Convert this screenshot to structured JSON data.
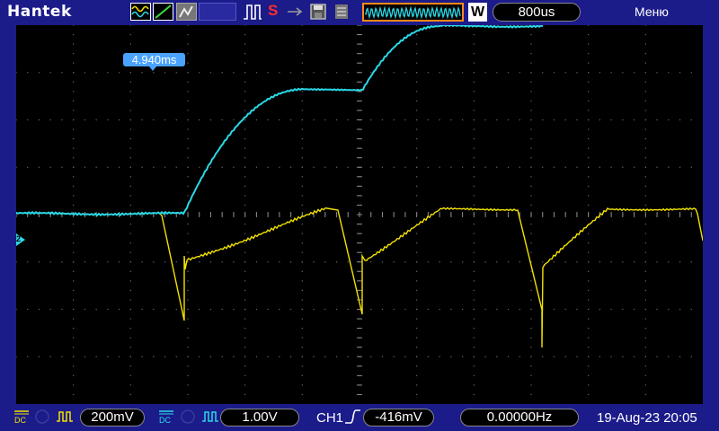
{
  "header": {
    "brand": "Hantek",
    "status": "S",
    "w_badge": "W",
    "timebase": "800us",
    "menu": "Меню"
  },
  "screen": {
    "trigger_position": "4.940ms",
    "ch2_marker": "2"
  },
  "footer": {
    "ch1_coupling": "DC",
    "ch1_scale": "200mV",
    "ch2_coupling": "DC",
    "ch2_scale": "1.00V",
    "trigger_source": "CH1",
    "trigger_level": "-416mV",
    "frequency": "0.00000Hz",
    "datetime": "19-Aug-23 20:05"
  },
  "colors": {
    "ch1": "#f2e200",
    "ch2": "#2ad8e6",
    "background": "#1b1b8a",
    "accent": "#ff8a1a",
    "marker": "#4aa3ff"
  },
  "icons": [
    "wave-icon",
    "slope-icon",
    "gray-icon",
    "run-icon",
    "usb-icon",
    "save-icon",
    "print-icon",
    "trigger-slope-icon"
  ]
}
